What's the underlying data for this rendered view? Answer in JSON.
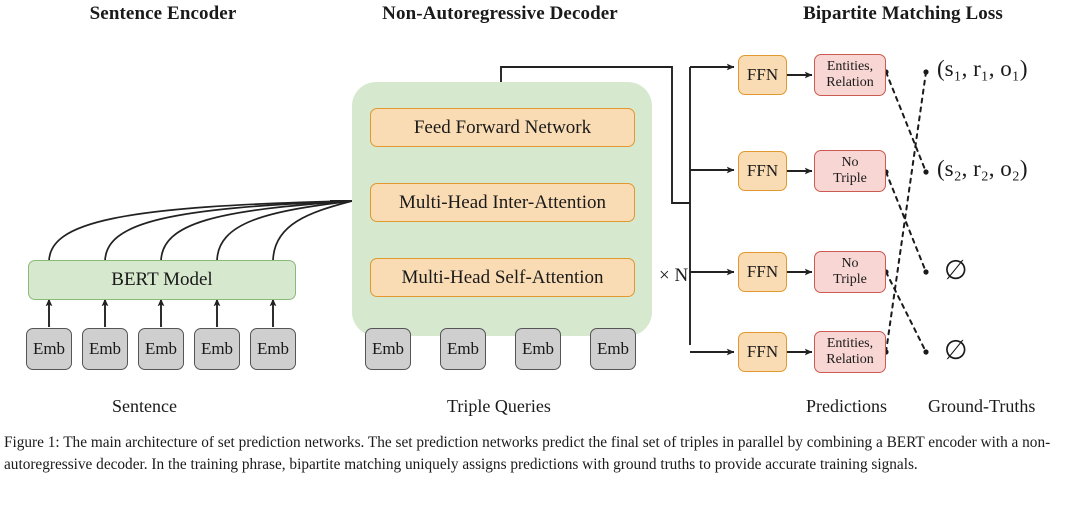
{
  "figure": {
    "caption": "Figure 1: The main architecture of set prediction networks. The set prediction networks predict the final set of triples in parallel by combining a BERT encoder with a non-autoregressive decoder. In the training phrase, bipartite matching uniquely assigns predictions with ground truths to provide accurate training signals."
  },
  "sections": {
    "encoder_title": "Sentence Encoder",
    "decoder_title": "Non-Autoregressive Decoder",
    "loss_title": "Bipartite Matching Loss"
  },
  "encoder": {
    "model_box": "BERT Model",
    "bottom_label": "Sentence",
    "embeddings": [
      {
        "label": "Emb"
      },
      {
        "label": "Emb"
      },
      {
        "label": "Emb"
      },
      {
        "label": "Emb"
      },
      {
        "label": "Emb"
      }
    ]
  },
  "decoder": {
    "layers": [
      {
        "label": "Feed Forward Network"
      },
      {
        "label": "Multi-Head Inter-Attention"
      },
      {
        "label": "Multi-Head Self-Attention"
      }
    ],
    "repeat_label": "× N",
    "bottom_label": "Triple Queries",
    "embeddings": [
      {
        "label": "Emb"
      },
      {
        "label": "Emb"
      },
      {
        "label": "Emb"
      },
      {
        "label": "Emb"
      }
    ]
  },
  "loss": {
    "ffn_label": "FFN",
    "ffn_blocks": [
      {
        "label": "FFN"
      },
      {
        "label": "FFN"
      },
      {
        "label": "FFN"
      },
      {
        "label": "FFN"
      }
    ],
    "predictions_label": "Predictions",
    "ground_truths_label": "Ground-Truths",
    "predictions": [
      {
        "line1": "Entities,",
        "line2": "Relation"
      },
      {
        "line1": "No",
        "line2": "Triple"
      },
      {
        "line1": "No",
        "line2": "Triple"
      },
      {
        "line1": "Entities,",
        "line2": "Relation"
      }
    ],
    "ground_truths": [
      {
        "text": "(s₁, r₁, o₁)",
        "kind": "triple"
      },
      {
        "text": "(s₂, r₂, o₂)",
        "kind": "triple"
      },
      {
        "text": "∅",
        "kind": "empty"
      },
      {
        "text": "∅",
        "kind": "empty"
      }
    ],
    "matching": [
      {
        "from_prediction": 1,
        "to_ground_truth": 2
      },
      {
        "from_prediction": 2,
        "to_ground_truth": 3
      },
      {
        "from_prediction": 3,
        "to_ground_truth": 4
      },
      {
        "from_prediction": 4,
        "to_ground_truth": 1
      }
    ]
  },
  "colors": {
    "green_fill": "#d6e8cd",
    "green_border": "#8cb97a",
    "orange_fill": "#fadcb4",
    "orange_border": "#e0982f",
    "pink_fill": "#f8d6d3",
    "pink_border": "#cb5a50",
    "gray_fill": "#cfcfcf",
    "gray_border": "#555555",
    "line": "#222222"
  }
}
